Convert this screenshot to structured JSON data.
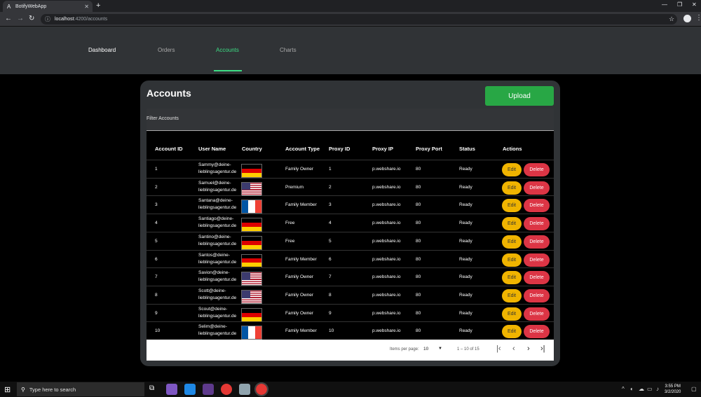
{
  "browser": {
    "tab_title": "BotifyWebApp",
    "tab_favicon": "A",
    "url_host": "localhost",
    "url_path": ":4200/accounts"
  },
  "nav": {
    "links": [
      "Dashboard",
      "Orders",
      "Accounts",
      "Charts"
    ],
    "active": "Accounts"
  },
  "card": {
    "title": "Accounts",
    "upload_label": "Upload",
    "filter_label": "Filter Accounts"
  },
  "table": {
    "headers": [
      "Account ID",
      "User Name",
      "Country",
      "Account Type",
      "Proxy ID",
      "Proxy IP",
      "Proxy Port",
      "Status",
      "Actions"
    ],
    "rows": [
      {
        "id": "1",
        "user1": "Sammy@deine-",
        "user2": "lieblingsagentur.de",
        "country": "de",
        "type": "Family Owner",
        "proxy_id": "1",
        "proxy_ip": "p.webshare.io",
        "port": "80",
        "status": "Ready"
      },
      {
        "id": "2",
        "user1": "Samuel@deine-",
        "user2": "lieblingsagentur.de",
        "country": "us",
        "type": "Premium",
        "proxy_id": "2",
        "proxy_ip": "p.webshare.io",
        "port": "80",
        "status": "Ready"
      },
      {
        "id": "3",
        "user1": "Santana@deine-",
        "user2": "lieblingsagentur.de",
        "country": "fr",
        "type": "Family Member",
        "proxy_id": "3",
        "proxy_ip": "p.webshare.io",
        "port": "80",
        "status": "Ready"
      },
      {
        "id": "4",
        "user1": "Santiago@deine-",
        "user2": "lieblingsagentur.de",
        "country": "de",
        "type": "Free",
        "proxy_id": "4",
        "proxy_ip": "p.webshare.io",
        "port": "80",
        "status": "Ready"
      },
      {
        "id": "5",
        "user1": "Santino@deine-",
        "user2": "lieblingsagentur.de",
        "country": "de",
        "type": "Free",
        "proxy_id": "5",
        "proxy_ip": "p.webshare.io",
        "port": "80",
        "status": "Ready"
      },
      {
        "id": "6",
        "user1": "Santos@deine-",
        "user2": "lieblingsagentur.de",
        "country": "de",
        "type": "Family Member",
        "proxy_id": "6",
        "proxy_ip": "p.webshare.io",
        "port": "80",
        "status": "Ready"
      },
      {
        "id": "7",
        "user1": "Savion@deine-",
        "user2": "lieblingsagentur.de",
        "country": "us",
        "type": "Family Owner",
        "proxy_id": "7",
        "proxy_ip": "p.webshare.io",
        "port": "80",
        "status": "Ready"
      },
      {
        "id": "8",
        "user1": "Scott@deine-",
        "user2": "lieblingsagentur.de",
        "country": "us",
        "type": "Family Owner",
        "proxy_id": "8",
        "proxy_ip": "p.webshare.io",
        "port": "80",
        "status": "Ready"
      },
      {
        "id": "9",
        "user1": "Scout@deine-",
        "user2": "lieblingsagentur.de",
        "country": "de",
        "type": "Family Owner",
        "proxy_id": "9",
        "proxy_ip": "p.webshare.io",
        "port": "80",
        "status": "Ready"
      },
      {
        "id": "10",
        "user1": "Selim@deine-",
        "user2": "lieblingsagentur.de",
        "country": "fr",
        "type": "Family Member",
        "proxy_id": "10",
        "proxy_ip": "p.webshare.io",
        "port": "80",
        "status": "Ready"
      }
    ],
    "edit_label": "Edit",
    "delete_label": "Delete"
  },
  "paginator": {
    "items_per_page_label": "Items per page:",
    "items_per_page_value": "10",
    "range_label": "1 – 10 of 15"
  },
  "taskbar": {
    "search_placeholder": "Type here to search",
    "time": "3:55 PM",
    "date": "3/2/2020"
  },
  "colors": {
    "accent_green": "#3ddc84",
    "upload_green": "#28a745",
    "edit_yellow": "#f0b400",
    "delete_red": "#dc3545"
  }
}
